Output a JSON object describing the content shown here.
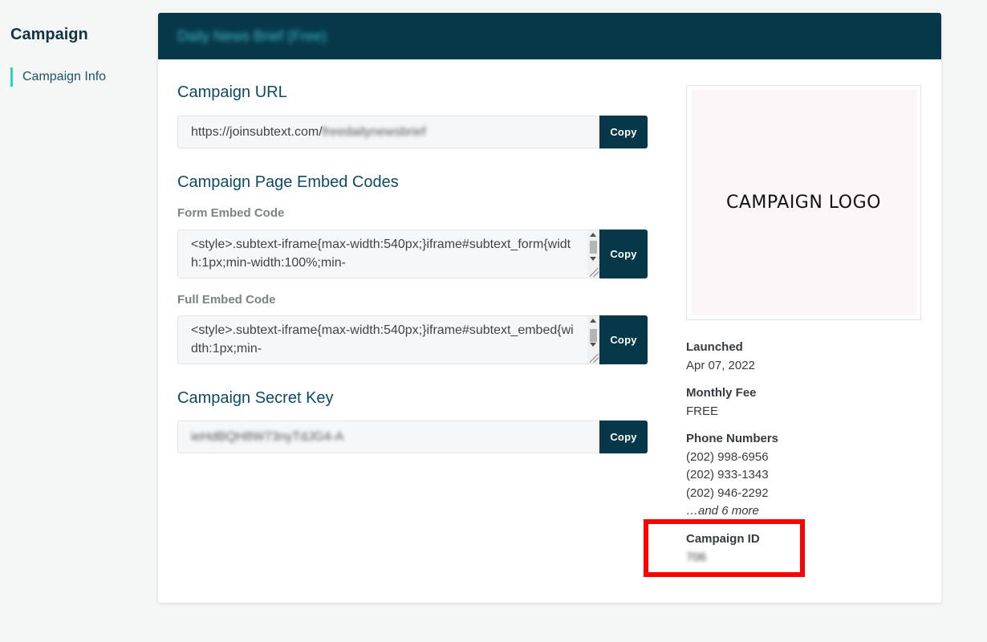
{
  "sidebar": {
    "title": "Campaign",
    "items": [
      {
        "label": "Campaign Info"
      }
    ]
  },
  "card": {
    "header_title": "Daily News Brief (Free)",
    "url_section": {
      "title": "Campaign URL",
      "url_prefix": "https://joinsubtext.com/",
      "url_slug": "freedailynewsbrief",
      "copy_label": "Copy"
    },
    "embed_section": {
      "title": "Campaign Page Embed Codes",
      "form_label": "Form Embed Code",
      "form_code": "<style>.subtext-iframe{max-width:540px;}iframe#subtext_form{width:1px;min-width:100%;min-",
      "full_label": "Full Embed Code",
      "full_code": "<style>.subtext-iframe{max-width:540px;}iframe#subtext_embed{width:1px;min-",
      "copy_label": "Copy"
    },
    "secret_section": {
      "title": "Campaign Secret Key",
      "secret_value": "ieHdBQH8W73nyTdJG4-A",
      "copy_label": "Copy"
    },
    "logo_text": "CAMPAIGN LOGO",
    "launched": {
      "label": "Launched",
      "value": "Apr 07, 2022"
    },
    "monthly_fee": {
      "label": "Monthly Fee",
      "value": "FREE"
    },
    "phone_numbers": {
      "label": "Phone Numbers",
      "numbers": [
        "(202) 998-6956",
        "(202) 933-1343",
        "(202) 946-2292"
      ],
      "more_text": "…and 6 more"
    },
    "campaign_id": {
      "label": "Campaign ID",
      "value": "706"
    }
  },
  "colors": {
    "header_bg": "#07384a",
    "button_bg": "#07384a",
    "accent": "#2dd4bf",
    "highlight": "#ff0000",
    "section_title": "#0d4b62"
  },
  "icons": [
    "scroll-up-arrow-icon",
    "scroll-down-arrow-icon",
    "resize-grip-icon"
  ]
}
